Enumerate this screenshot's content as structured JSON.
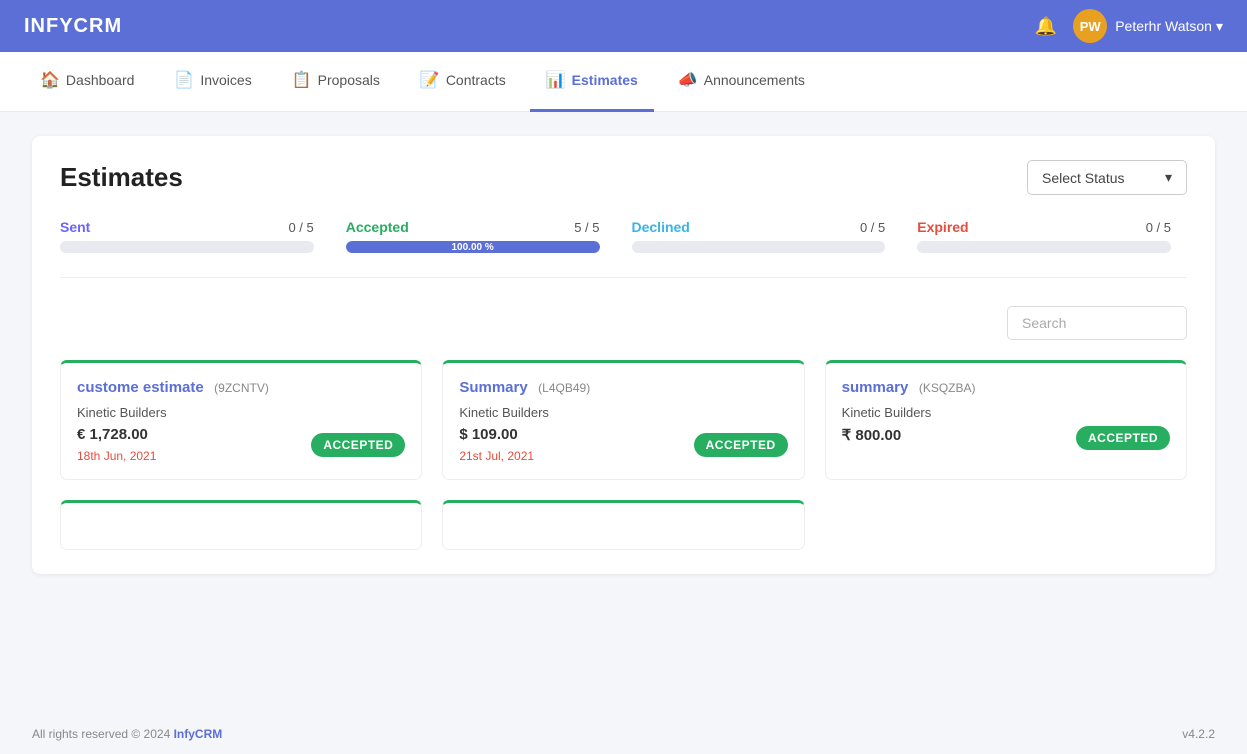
{
  "header": {
    "logo": "INFYCRM",
    "bell_icon": "🔔",
    "avatar_initials": "PW",
    "username": "Peterhr Watson",
    "dropdown_icon": "▾"
  },
  "nav": {
    "items": [
      {
        "id": "dashboard",
        "label": "Dashboard",
        "icon": "🏠",
        "active": false
      },
      {
        "id": "invoices",
        "label": "Invoices",
        "icon": "📄",
        "active": false
      },
      {
        "id": "proposals",
        "label": "Proposals",
        "icon": "📋",
        "active": false
      },
      {
        "id": "contracts",
        "label": "Contracts",
        "icon": "📝",
        "active": false
      },
      {
        "id": "estimates",
        "label": "Estimates",
        "icon": "📊",
        "active": true
      },
      {
        "id": "announcements",
        "label": "Announcements",
        "icon": "📣",
        "active": false
      }
    ]
  },
  "page": {
    "title": "Estimates",
    "select_status_label": "Select Status",
    "select_status_dropdown_icon": "▾",
    "stats": [
      {
        "id": "sent",
        "label": "Sent",
        "count": "0 / 5",
        "fill_pct": 0,
        "fill_text": "",
        "type": "sent"
      },
      {
        "id": "accepted",
        "label": "Accepted",
        "count": "5 / 5",
        "fill_pct": 100,
        "fill_text": "100.00 %",
        "type": "accepted"
      },
      {
        "id": "declined",
        "label": "Declined",
        "count": "0 / 5",
        "fill_pct": 0,
        "fill_text": "",
        "type": "declined"
      },
      {
        "id": "expired",
        "label": "Expired",
        "count": "0 / 5",
        "fill_pct": 0,
        "fill_text": "",
        "type": "expired"
      }
    ],
    "search_placeholder": "Search",
    "cards": [
      {
        "title": "custome estimate",
        "code": "9ZCNTV",
        "company": "Kinetic Builders",
        "amount": "€ 1,728.00",
        "date": "18th Jun, 2021",
        "status": "ACCEPTED"
      },
      {
        "title": "Summary",
        "code": "L4QB49",
        "company": "Kinetic Builders",
        "amount": "$ 109.00",
        "date": "21st Jul, 2021",
        "status": "ACCEPTED"
      },
      {
        "title": "summary",
        "code": "KSQZBA",
        "company": "Kinetic Builders",
        "amount": "₹ 800.00",
        "date": "",
        "status": "ACCEPTED"
      }
    ]
  },
  "footer": {
    "copyright": "All rights reserved © 2024 ",
    "brand": "InfyCRM",
    "version": "v4.2.2"
  }
}
